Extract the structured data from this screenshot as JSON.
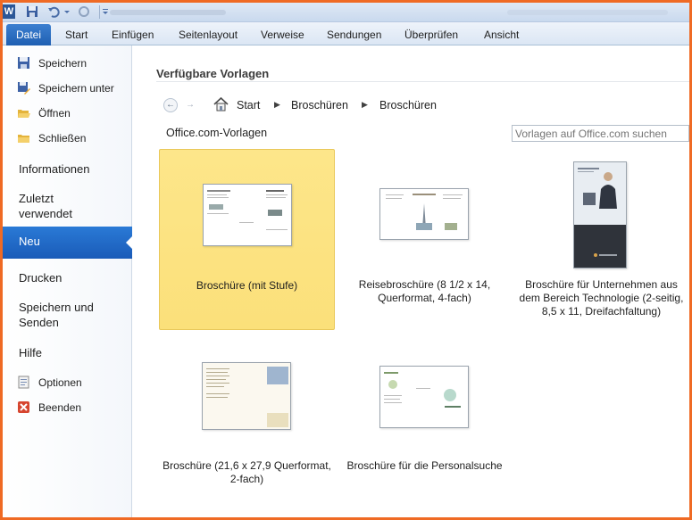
{
  "ribbon": {
    "file_tab": "Datei",
    "tabs": [
      "Start",
      "Einfügen",
      "Seitenlayout",
      "Verweise",
      "Sendungen",
      "Überprüfen",
      "Ansicht"
    ]
  },
  "nav": {
    "save": "Speichern",
    "save_as": "Speichern unter",
    "open": "Öffnen",
    "close": "Schließen",
    "info": "Informationen",
    "recent_1": "Zuletzt",
    "recent_2": "verwendet",
    "new": "Neu",
    "print": "Drucken",
    "save_send_1": "Speichern und",
    "save_send_2": "Senden",
    "help": "Hilfe",
    "options": "Optionen",
    "exit": "Beenden"
  },
  "content": {
    "title": "Verfügbare Vorlagen",
    "breadcrumb": [
      "Start",
      "Broschüren",
      "Broschüren"
    ],
    "subtitle": "Office.com-Vorlagen",
    "search_placeholder": "Vorlagen auf Office.com suchen",
    "templates": [
      {
        "label_1": "Broschüre (mit Stufe)",
        "label_2": "",
        "label_3": ""
      },
      {
        "label_1": "Reisebroschüre (8 1/2 x 14,",
        "label_2": "Querformat, 4-fach)",
        "label_3": ""
      },
      {
        "label_1": "Broschüre für Unternehmen aus",
        "label_2": "dem Bereich Technologie (2-seitig,",
        "label_3": "8,5 x 11, Dreifachfaltung)"
      },
      {
        "label_1": "Broschüre (21,6 x 27,9 Querformat,",
        "label_2": "2-fach)",
        "label_3": ""
      },
      {
        "label_1": "Broschüre für die Personalsuche",
        "label_2": "",
        "label_3": ""
      }
    ]
  },
  "colors": {
    "frame": "#ef6a24",
    "file_tab": "#2b6fc8",
    "selected_tile": "#fbe07a",
    "nav_active": "#1f64c4"
  }
}
